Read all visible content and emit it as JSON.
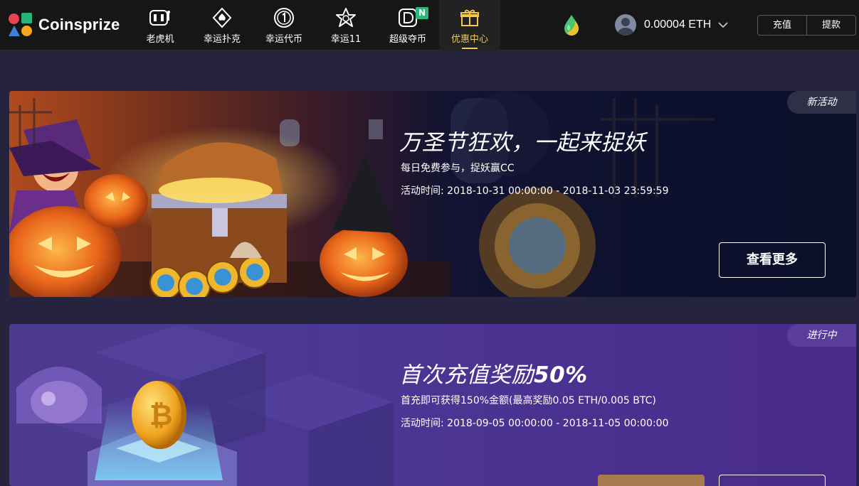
{
  "brand": {
    "name": "Coinsprize"
  },
  "nav": {
    "items": [
      {
        "label": "老虎机",
        "icon": "slot-machine-icon"
      },
      {
        "label": "幸运扑克",
        "icon": "spade-icon"
      },
      {
        "label": "幸运代币",
        "icon": "coin-1-icon"
      },
      {
        "label": "幸运11",
        "icon": "star-icon"
      },
      {
        "label": "超级夺币",
        "icon": "d-coin-icon",
        "badge": "N"
      },
      {
        "label": "优惠中心",
        "icon": "gift-icon",
        "active": true
      }
    ]
  },
  "account": {
    "balance": "0.00004 ETH"
  },
  "funds": {
    "deposit": "充值",
    "withdraw": "提款"
  },
  "promotions": [
    {
      "status": "新活动",
      "title": "万圣节狂欢，一起来捉妖",
      "subtitle": "每日免费参与，捉妖赢CC",
      "time": "活动时间: 2018-10-31 00:00:00 - 2018-11-03 23:59:59",
      "button": "查看更多"
    },
    {
      "status": "进行中",
      "title_prefix": "首次充值奖励",
      "title_highlight": "50%",
      "subtitle": "首充即可获得150%金额(最高奖励0.05 ETH/0.005 BTC)",
      "time": "活动时间: 2018-09-05 00:00:00 - 2018-11-05 00:00:00"
    }
  ],
  "colors": {
    "accent": "#f2c94c",
    "badge": "#2fb67a",
    "header_bg": "#161616",
    "page_bg": "#26233f"
  }
}
